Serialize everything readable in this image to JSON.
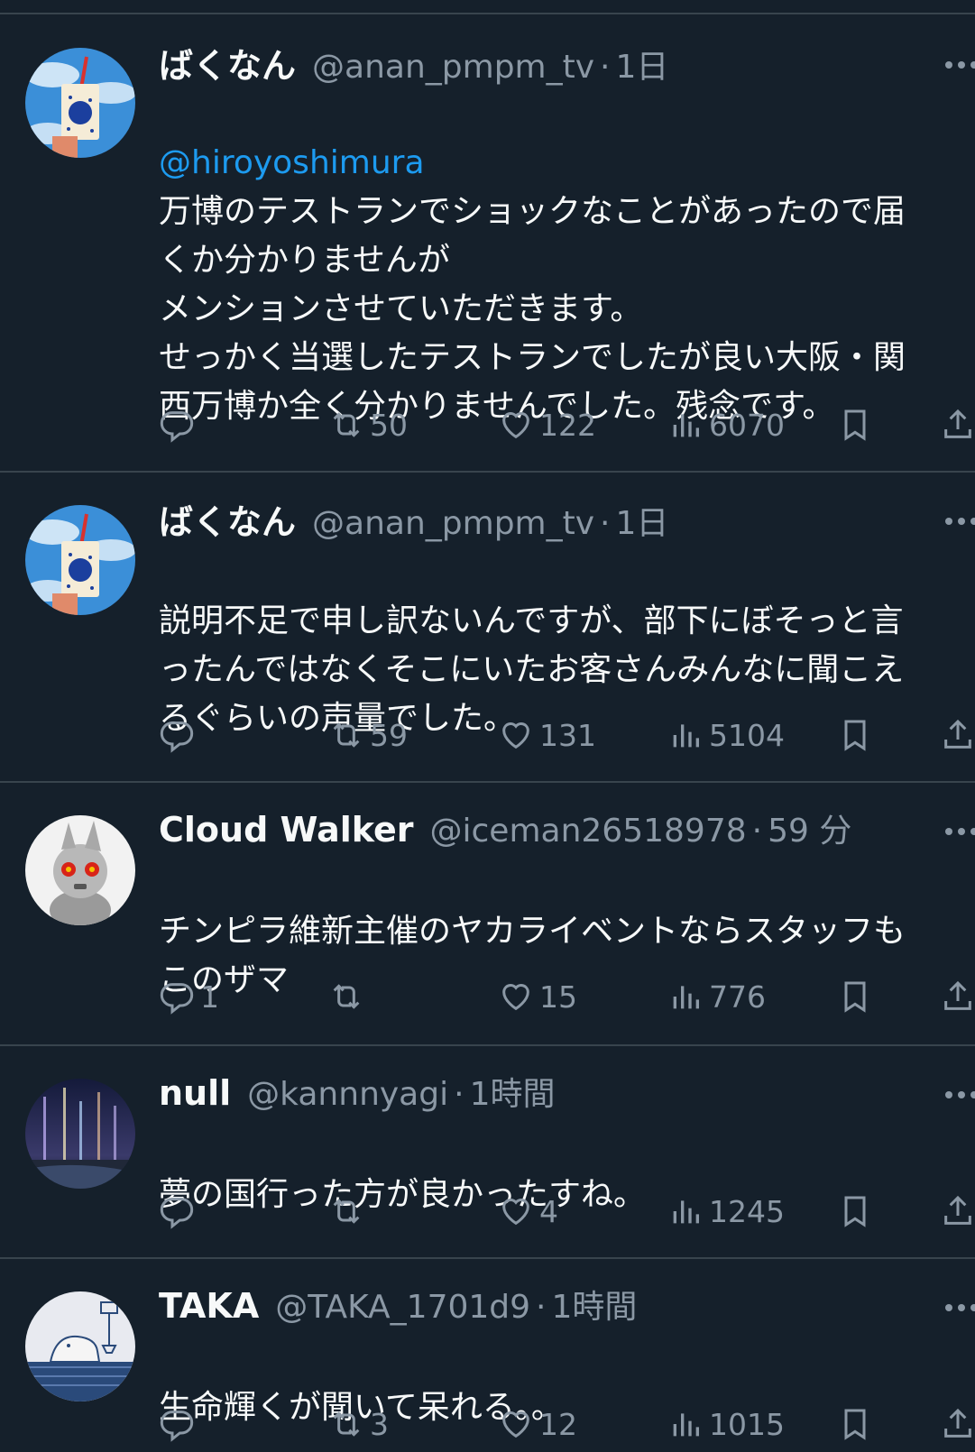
{
  "tweets": [
    {
      "name": "ばくなん",
      "handle": "@anan_pmpm_tv",
      "dot": "·",
      "time": "1日",
      "mention": "@hiroyoshimura",
      "text": "万博のテストランでショックなことがあったので届\nくか分かりませんが\nメンションさせていただきます。\nせっかく当選したテストランでしたが良い大阪・関\n西万博か全く分かりませんでした。残念です。",
      "replies": "",
      "retweets": "50",
      "likes": "122",
      "views": "6070"
    },
    {
      "name": "ばくなん",
      "handle": "@anan_pmpm_tv",
      "dot": "·",
      "time": "1日",
      "mention": "",
      "text": "説明不足で申し訳ないんですが、部下にぼそっと言\nったんではなくそこにいたお客さんみんなに聞こえ\nるぐらいの声量でした。",
      "replies": "",
      "retweets": "59",
      "likes": "131",
      "views": "5104"
    },
    {
      "name": "Cloud Walker",
      "handle": "@iceman26518978",
      "dot": "·",
      "time": "59 分",
      "mention": "",
      "text": "チンピラ維新主催のヤカライベントならスタッフも\nこのザマ",
      "replies": "1",
      "retweets": "",
      "likes": "15",
      "views": "776"
    },
    {
      "name": "null",
      "handle": "@kannnyagi",
      "dot": "·",
      "time": "1時間",
      "mention": "",
      "text": "夢の国行った方が良かったすね。",
      "replies": "",
      "retweets": "",
      "likes": "4",
      "views": "1245"
    },
    {
      "name": "TAKA",
      "handle": "@TAKA_1701d9",
      "dot": "·",
      "time": "1時間",
      "mention": "",
      "text": "生命輝くが聞いて呆れる。。",
      "replies": "",
      "retweets": "3",
      "likes": "12",
      "views": "1015"
    }
  ],
  "colors": {
    "background": "#15202b",
    "divider": "#38444d",
    "text": "#f7f9f9",
    "secondary": "#8b98a5",
    "link": "#1d9bf0"
  },
  "icons": {
    "reply": "reply-icon",
    "retweet": "retweet-icon",
    "like": "heart-icon",
    "views": "views-icon",
    "bookmark": "bookmark-icon",
    "share": "share-icon",
    "more": "more-icon"
  }
}
